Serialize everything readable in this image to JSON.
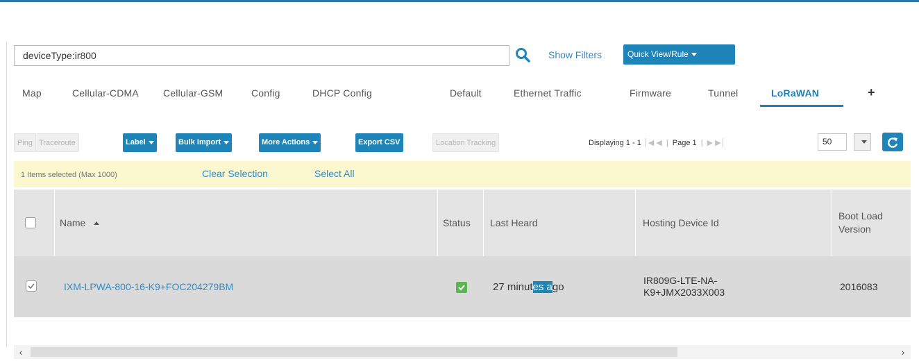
{
  "search": {
    "value": "deviceType:ir800"
  },
  "header": {
    "show_filters": "Show Filters",
    "quick_view": "Quick View/Rule"
  },
  "tabs": [
    {
      "label": "Map"
    },
    {
      "label": "Cellular-CDMA"
    },
    {
      "label": "Cellular-GSM"
    },
    {
      "label": "Config"
    },
    {
      "label": "DHCP Config"
    },
    {
      "label": "Default"
    },
    {
      "label": "Ethernet Traffic"
    },
    {
      "label": "Firmware"
    },
    {
      "label": "Tunnel"
    },
    {
      "label": "LoRaWAN",
      "active": true
    },
    {
      "label": "+"
    }
  ],
  "toolbar": {
    "ping": "Ping",
    "traceroute": "Traceroute",
    "label": "Label",
    "bulk_import": "Bulk Import",
    "more_actions": "More Actions",
    "export_csv": "Export CSV",
    "location_tracking": "Location Tracking",
    "displaying": "Displaying 1 - 1",
    "page": "Page 1",
    "page_size": "50"
  },
  "selection": {
    "count_text": "1 Items selected (Max 1000)",
    "clear": "Clear Selection",
    "select_all": "Select All"
  },
  "table": {
    "columns": {
      "name": "Name",
      "status": "Status",
      "last_heard": "Last Heard",
      "hosting_device": "Hosting Device Id",
      "boot_loader_1": "Boot Load",
      "boot_loader_2": "Version"
    },
    "rows": [
      {
        "name": "IXM-LPWA-800-16-K9+FOC204279BM",
        "status": "ok",
        "last_heard_pre": "27 minut",
        "last_heard_sel": "es a",
        "last_heard_post": "go",
        "hosting_device_1": "IR809G-LTE-NA-",
        "hosting_device_2": "K9+JMX2033X003",
        "boot_loader": "2016083"
      }
    ]
  },
  "colors": {
    "accent": "#1f85b8",
    "link": "#2f8bc4",
    "selection_bar": "#fbf8cf",
    "status_ok": "#5ab552"
  }
}
